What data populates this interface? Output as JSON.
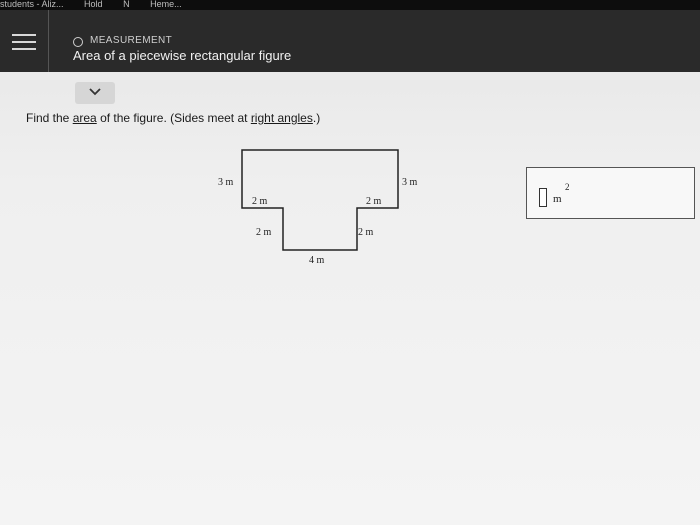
{
  "browser": {
    "tabs": [
      "students - Aliz...",
      "Hold",
      "N",
      "Heme..."
    ]
  },
  "header": {
    "topic": "MEASUREMENT",
    "title": "Area of a piecewise rectangular figure"
  },
  "question": {
    "prompt_before": "Find the ",
    "prompt_area": "area",
    "prompt_middle": " of the figure. (Sides meet at ",
    "prompt_right_angles": "right angles",
    "prompt_after": ".)"
  },
  "figure": {
    "label_left_side": "3 m",
    "label_right_side": "3 m",
    "label_left_ledge": "2 m",
    "label_right_ledge": "2 m",
    "label_left_drop": "2 m",
    "label_right_drop": "2 m",
    "label_bottom": "4 m"
  },
  "answer": {
    "value": "",
    "unit": "m",
    "exponent": "2"
  }
}
